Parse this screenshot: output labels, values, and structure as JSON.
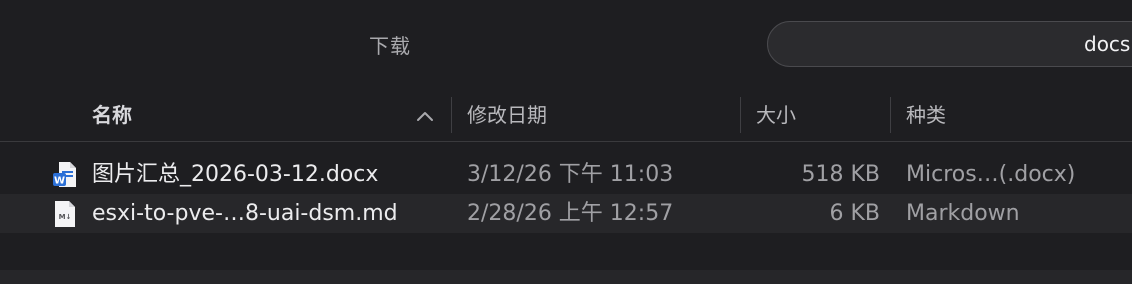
{
  "window": {
    "title": "下载",
    "search_text": "docs"
  },
  "columns": {
    "name": "名称",
    "date_modified": "修改日期",
    "size": "大小",
    "kind": "种类"
  },
  "files": [
    {
      "icon": "word-document-icon",
      "name": "图片汇总_2026-03-12.docx",
      "date": "3/12/26 下午 11:03",
      "size": "518 KB",
      "kind": "Micros…(.docx)"
    },
    {
      "icon": "markdown-file-icon",
      "name": "esxi-to-pve-…8-uai-dsm.md",
      "date": "2/28/26 上午 12:57",
      "size": "6 KB",
      "kind": "Markdown"
    }
  ],
  "colors": {
    "background": "#1e1e21",
    "row_alt": "#27272a",
    "word_blue": "#2b6fd6"
  }
}
